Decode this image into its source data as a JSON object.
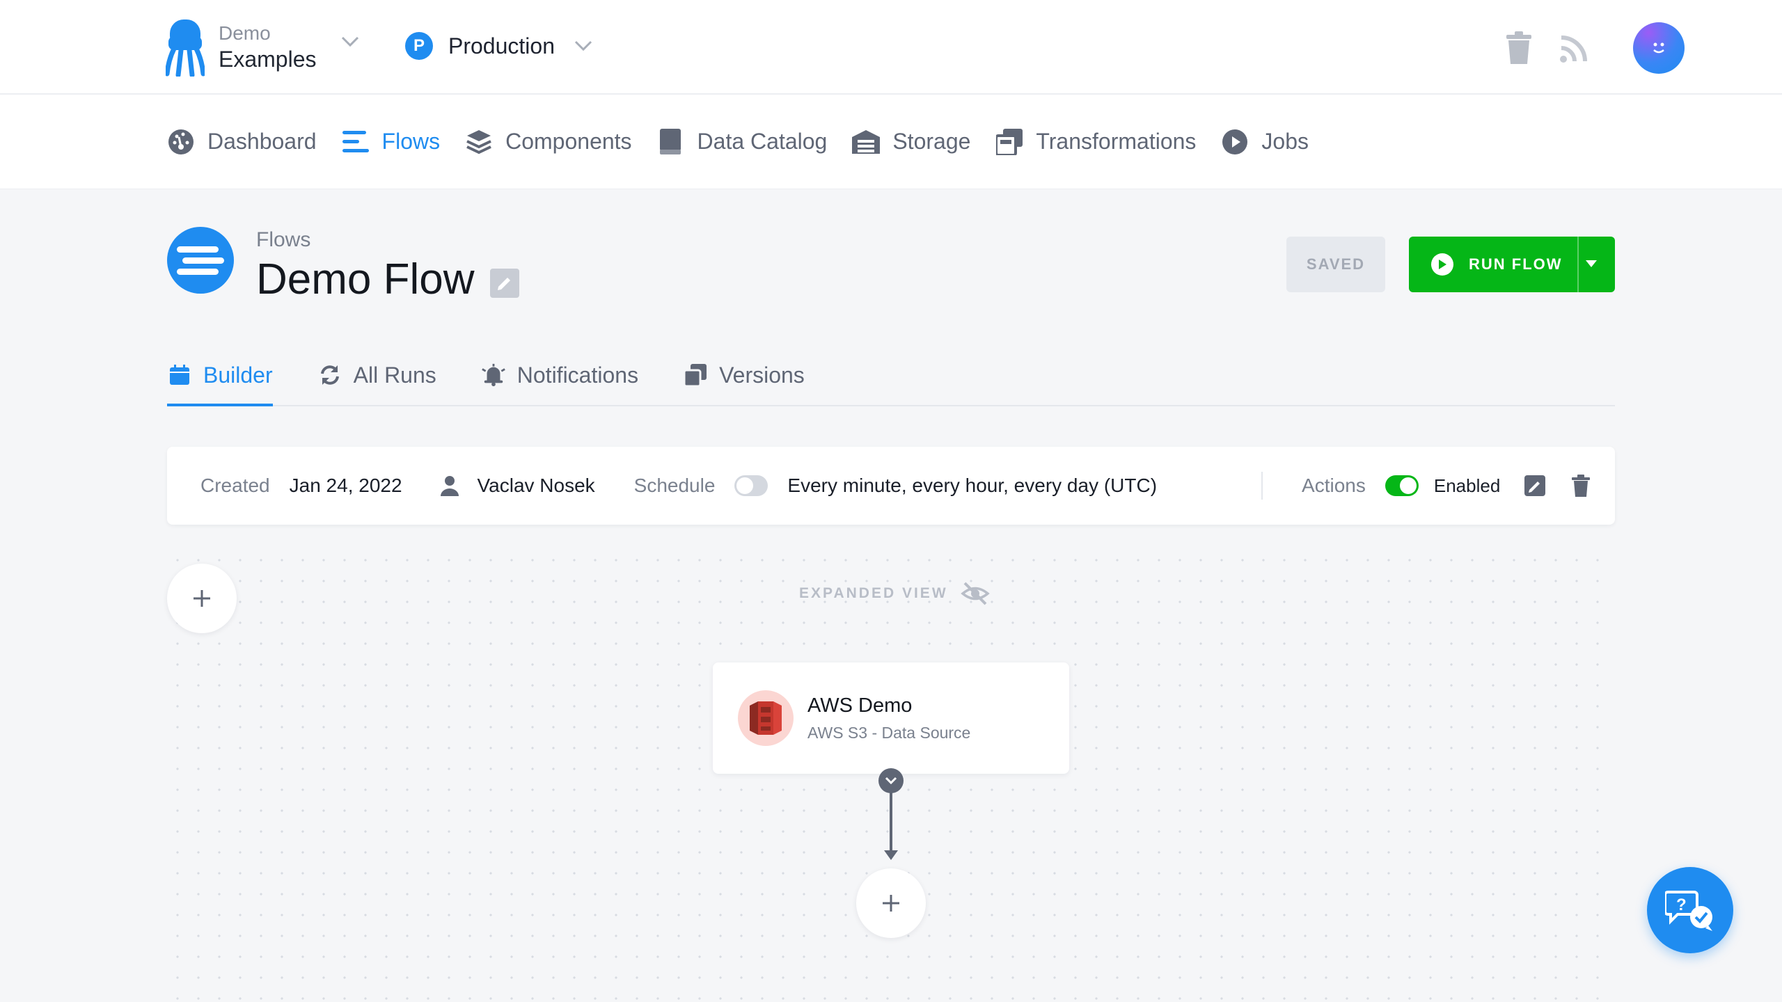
{
  "header": {
    "brand": {
      "sub": "Demo",
      "main": "Examples"
    },
    "project": {
      "badge": "P",
      "name": "Production"
    }
  },
  "nav": {
    "items": [
      {
        "label": "Dashboard",
        "icon": "gauge-icon",
        "active": false
      },
      {
        "label": "Flows",
        "icon": "flows-icon",
        "active": true
      },
      {
        "label": "Components",
        "icon": "layers-icon",
        "active": false
      },
      {
        "label": "Data Catalog",
        "icon": "book-icon",
        "active": false
      },
      {
        "label": "Storage",
        "icon": "warehouse-icon",
        "active": false
      },
      {
        "label": "Transformations",
        "icon": "transformations-icon",
        "active": false
      },
      {
        "label": "Jobs",
        "icon": "play-circle-icon",
        "active": false
      }
    ]
  },
  "page": {
    "breadcrumb": "Flows",
    "title": "Demo Flow",
    "saved_label": "SAVED",
    "run_label": "RUN FLOW"
  },
  "tabs": [
    {
      "label": "Builder",
      "icon": "calendar-icon",
      "active": true
    },
    {
      "label": "All Runs",
      "icon": "refresh-icon",
      "active": false
    },
    {
      "label": "Notifications",
      "icon": "bell-icon",
      "active": false
    },
    {
      "label": "Versions",
      "icon": "versions-icon",
      "active": false
    }
  ],
  "info": {
    "created_label": "Created",
    "created_value": "Jan 24, 2022",
    "author": "Vaclav Nosek",
    "schedule_label": "Schedule",
    "schedule_enabled": false,
    "schedule_value": "Every minute, every hour, every day (UTC)",
    "actions_label": "Actions",
    "actions_enabled": true,
    "enabled_label": "Enabled"
  },
  "canvas": {
    "expanded_label": "EXPANDED VIEW",
    "node": {
      "name": "AWS Demo",
      "subtitle": "AWS S3 - Data Source",
      "icon": "aws-s3-icon"
    }
  },
  "colors": {
    "accent": "#1f8cf0",
    "run_green": "#05b617",
    "node_icon_bg": "#fbd6d2",
    "aws_red": "#d9433a"
  }
}
